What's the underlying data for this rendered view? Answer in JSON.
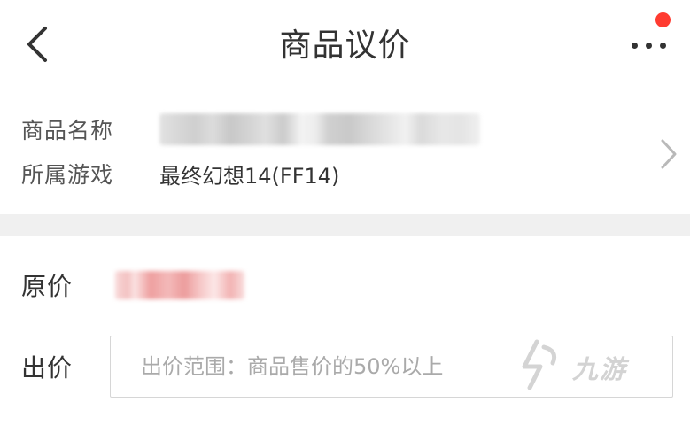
{
  "header": {
    "title": "商品议价",
    "back_icon": "chevron-left-icon",
    "more_icon": "more-horizontal-icon",
    "notification_color": "#ff3b30"
  },
  "product": {
    "name_label": "商品名称",
    "game_label": "所属游戏",
    "game_value": "最终幻想14(FF14)"
  },
  "price": {
    "original_label": "原价",
    "offer_label": "出价",
    "offer_placeholder": "出价范围：商品售价的50%以上",
    "offer_value": ""
  },
  "watermark": {
    "text": "九游"
  },
  "colors": {
    "accent_red": "#ff3b30",
    "separator_gray": "#f0f0f0",
    "label_gray": "#555555",
    "placeholder_gray": "#aaaaaa"
  }
}
